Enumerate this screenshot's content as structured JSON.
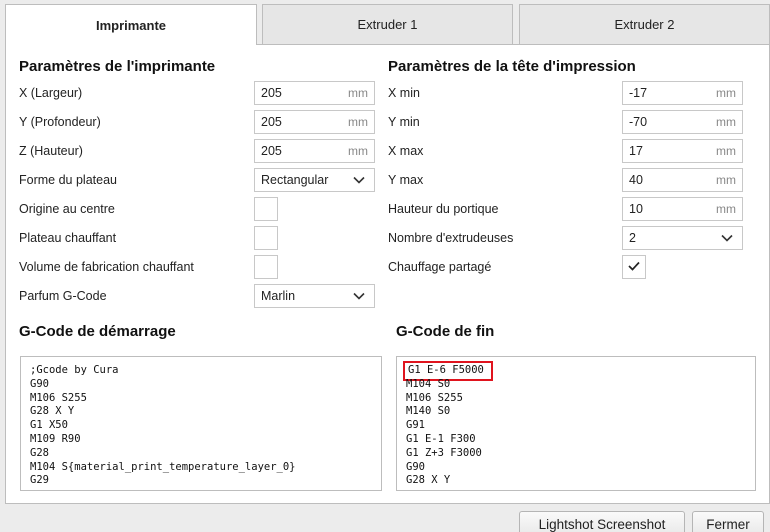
{
  "tabs": [
    {
      "label": "Imprimante",
      "active": true
    },
    {
      "label": "Extruder 1",
      "active": false
    },
    {
      "label": "Extruder 2",
      "active": false
    }
  ],
  "printer_settings": {
    "title": "Paramètres de l'imprimante",
    "width_label": "X (Largeur)",
    "width_value": "205",
    "width_unit": "mm",
    "depth_label": "Y (Profondeur)",
    "depth_value": "205",
    "depth_unit": "mm",
    "height_label": "Z (Hauteur)",
    "height_value": "205",
    "height_unit": "mm",
    "plate_shape_label": "Forme du plateau",
    "plate_shape_value": "Rectangular",
    "origin_center_label": "Origine au centre",
    "origin_center_checked": false,
    "heated_bed_label": "Plateau chauffant",
    "heated_bed_checked": false,
    "heated_volume_label": "Volume de fabrication chauffant",
    "heated_volume_checked": false,
    "gcode_flavor_label": "Parfum G-Code",
    "gcode_flavor_value": "Marlin"
  },
  "printhead_settings": {
    "title": "Paramètres de la tête d'impression",
    "xmin_label": "X min",
    "xmin_value": "-17",
    "xmin_unit": "mm",
    "ymin_label": "Y min",
    "ymin_value": "-70",
    "ymin_unit": "mm",
    "xmax_label": "X max",
    "xmax_value": "17",
    "xmax_unit": "mm",
    "ymax_label": "Y max",
    "ymax_value": "40",
    "ymax_unit": "mm",
    "gantry_label": "Hauteur du portique",
    "gantry_value": "10",
    "gantry_unit": "mm",
    "extruders_label": "Nombre d'extrudeuses",
    "extruders_value": "2",
    "shared_heater_label": "Chauffage partagé",
    "shared_heater_checked": true
  },
  "start_gcode": {
    "title": "G-Code de démarrage",
    "lines": [
      ";Gcode by Cura",
      "G90",
      "M106 S255",
      "G28 X Y",
      "G1 X50",
      "M109 R90",
      "G28",
      "M104 S{material_print_temperature_layer_0}",
      "G29"
    ]
  },
  "end_gcode": {
    "title": "G-Code de fin",
    "lines": [
      "G1 E-6 F5000",
      "M104 S0",
      "M106 S255",
      "M140 S0",
      "G91",
      "G1 E-1 F300",
      "G1 Z+3 F3000",
      "G90",
      "G28 X Y"
    ]
  },
  "buttons": {
    "screenshot_label": "Lightshot Screenshot",
    "close_label": "Fermer"
  },
  "colors": {
    "highlight": "#e0141e",
    "background": "#ececec",
    "panel": "#ffffff"
  }
}
